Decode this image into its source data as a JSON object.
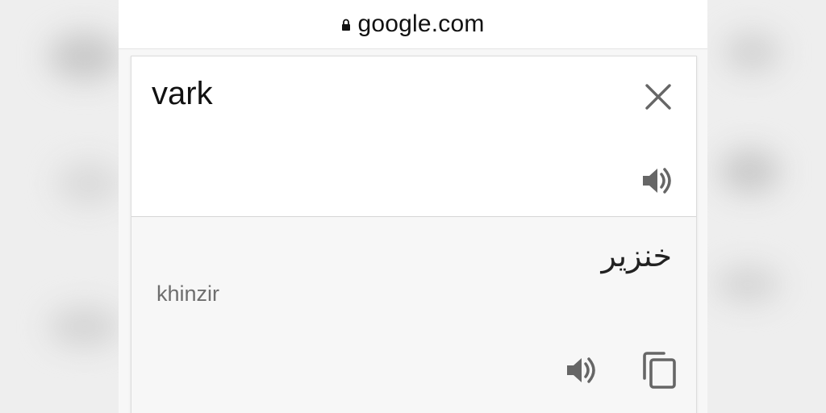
{
  "browser": {
    "address": "google.com"
  },
  "translate": {
    "source_text": "vark",
    "target_text": "خنزير",
    "transliteration": "khinzir"
  },
  "icons": {
    "lock": "lock-icon",
    "clear": "close-icon",
    "speak": "speaker-icon",
    "copy": "copy-icon"
  },
  "colors": {
    "icon_gray": "#666666",
    "text_dark": "#111111",
    "translit_gray": "#6e6e6e",
    "result_bg": "#f7f7f7"
  }
}
